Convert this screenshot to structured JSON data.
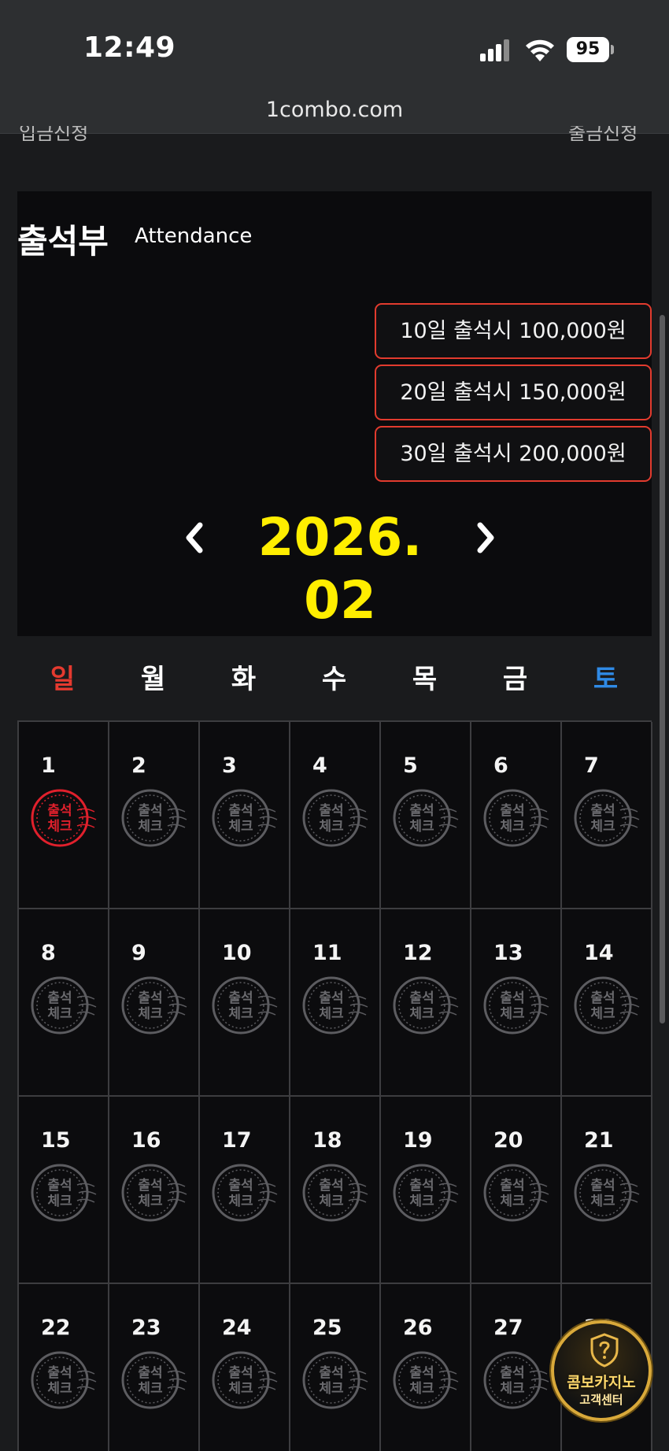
{
  "status_bar": {
    "time": "12:49",
    "battery": "95"
  },
  "browser": {
    "url": "1combo.com"
  },
  "cutoff": {
    "left": "입금신청",
    "right": "출금신청"
  },
  "attendance": {
    "title_ko": "출석부",
    "title_en": "Attendance",
    "rewards": [
      "10일 출석시 100,000원",
      "20일 출석시 150,000원",
      "30일 출석시 200,000원"
    ],
    "month_label": "2026. 02"
  },
  "weekdays": [
    "일",
    "월",
    "화",
    "수",
    "목",
    "금",
    "토"
  ],
  "colors": {
    "sunday": "#e53a2f",
    "saturday": "#2f8ae5",
    "month": "#ffee00",
    "accent_border": "#e23b2e"
  },
  "stamp_text": [
    "출석",
    "체크"
  ],
  "days": [
    {
      "day": "1",
      "checked": true
    },
    {
      "day": "2",
      "checked": false
    },
    {
      "day": "3",
      "checked": false
    },
    {
      "day": "4",
      "checked": false
    },
    {
      "day": "5",
      "checked": false
    },
    {
      "day": "6",
      "checked": false
    },
    {
      "day": "7",
      "checked": false
    },
    {
      "day": "8",
      "checked": false
    },
    {
      "day": "9",
      "checked": false
    },
    {
      "day": "10",
      "checked": false
    },
    {
      "day": "11",
      "checked": false
    },
    {
      "day": "12",
      "checked": false
    },
    {
      "day": "13",
      "checked": false
    },
    {
      "day": "14",
      "checked": false
    },
    {
      "day": "15",
      "checked": false
    },
    {
      "day": "16",
      "checked": false
    },
    {
      "day": "17",
      "checked": false
    },
    {
      "day": "18",
      "checked": false
    },
    {
      "day": "19",
      "checked": false
    },
    {
      "day": "20",
      "checked": false
    },
    {
      "day": "21",
      "checked": false
    },
    {
      "day": "22",
      "checked": false
    },
    {
      "day": "23",
      "checked": false
    },
    {
      "day": "24",
      "checked": false
    },
    {
      "day": "25",
      "checked": false
    },
    {
      "day": "26",
      "checked": false
    },
    {
      "day": "27",
      "checked": false
    },
    {
      "day": "28",
      "checked": false
    }
  ],
  "support_badge": {
    "line1": "콤보카지노",
    "line2": "고객센터"
  }
}
